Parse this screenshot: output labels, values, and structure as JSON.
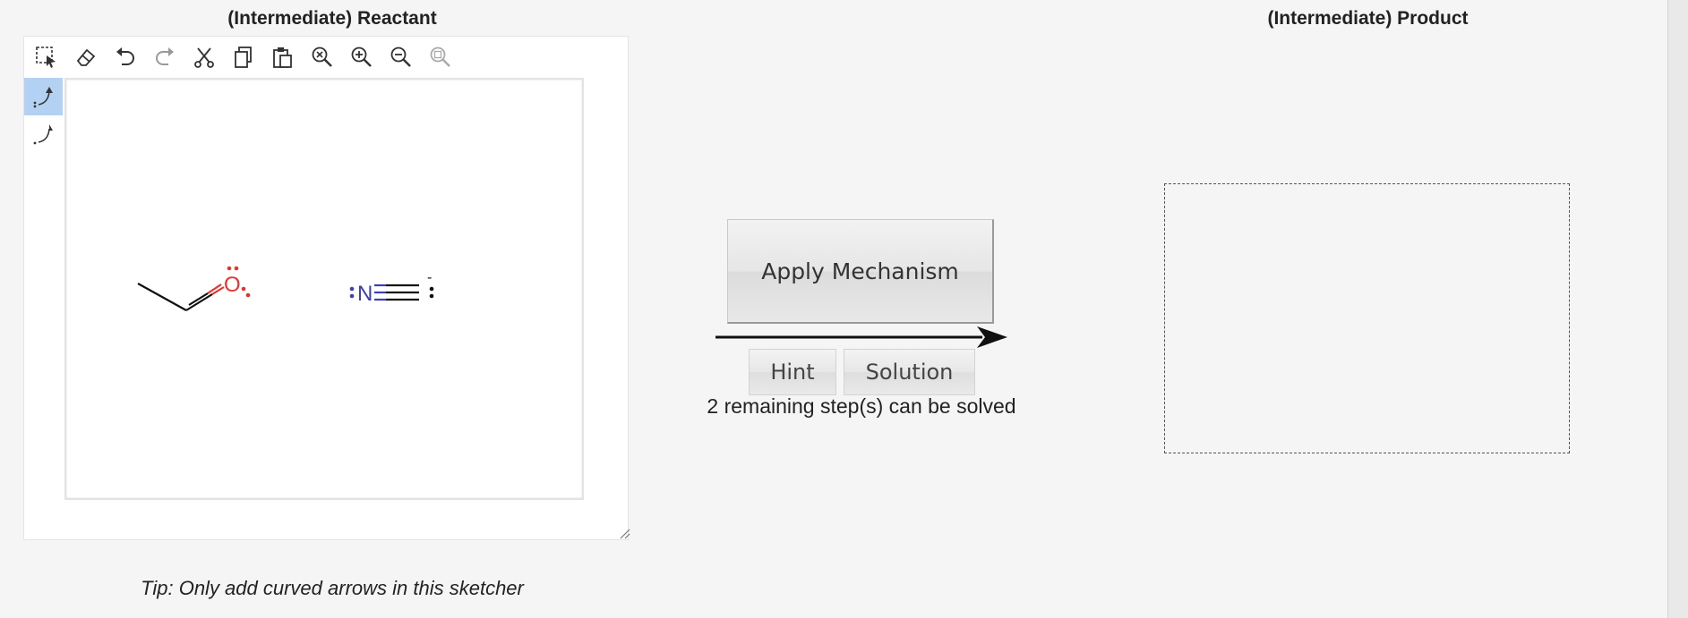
{
  "reactant_title": "(Intermediate) Reactant",
  "product_title": "(Intermediate) Product",
  "toolbar": {
    "icons": [
      "select-rect-icon",
      "eraser-icon",
      "undo-icon",
      "redo-icon",
      "cut-icon",
      "copy-icon",
      "paste-icon",
      "zoom-reset-icon",
      "zoom-in-icon",
      "zoom-out-icon",
      "zoom-fit-icon"
    ]
  },
  "side_tools": [
    "electron-pair-arrow-icon",
    "single-electron-arrow-icon"
  ],
  "molecules": {
    "oxygen_label": "O",
    "nitrogen_label": "N",
    "charge_label": "-"
  },
  "tip": "Tip: Only add curved arrows in this sketcher",
  "apply_label": "Apply Mechanism",
  "hint_label": "Hint",
  "solution_label": "Solution",
  "status": "2 remaining step(s) can be solved",
  "colors": {
    "oxygen": "#e8332c",
    "nitrogen": "#3b3fb5",
    "active_tool": "#b3d1f2"
  }
}
